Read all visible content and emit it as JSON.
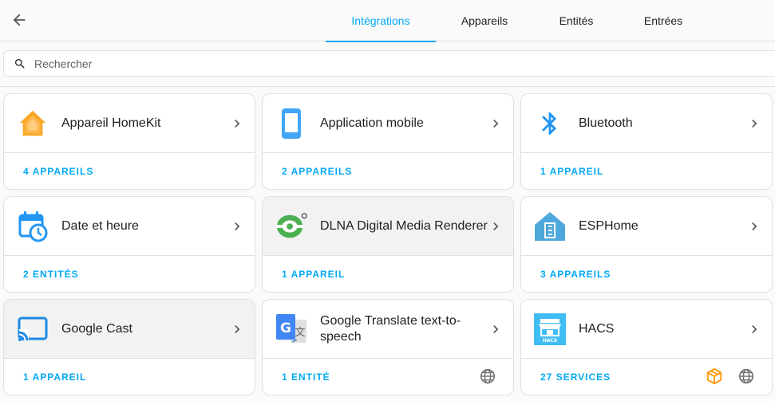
{
  "tabs": [
    {
      "label": "Intégrations",
      "active": true
    },
    {
      "label": "Appareils",
      "active": false
    },
    {
      "label": "Entités",
      "active": false
    },
    {
      "label": "Entrées",
      "active": false
    }
  ],
  "search": {
    "placeholder": "Rechercher"
  },
  "cards": [
    {
      "title": "Appareil HomeKit",
      "footer": "4 APPAREILS",
      "icon": "homekit-house-icon"
    },
    {
      "title": "Application mobile",
      "footer": "2 APPAREILS",
      "icon": "mobile-phone-icon"
    },
    {
      "title": "Bluetooth",
      "footer": "1 APPAREIL",
      "icon": "bluetooth-icon"
    },
    {
      "title": "Date et heure",
      "footer": "2 ENTITÉS",
      "icon": "calendar-clock-icon"
    },
    {
      "title": "DLNA Digital Media Renderer",
      "footer": "1 APPAREIL",
      "icon": "dlna-icon"
    },
    {
      "title": "ESPHome",
      "footer": "3 APPAREILS",
      "icon": "esphome-icon"
    },
    {
      "title": "Google Cast",
      "footer": "1 APPAREIL",
      "icon": "cast-icon"
    },
    {
      "title": "Google Translate text-to-speech",
      "footer": "1 ENTITÉ",
      "icon": "google-translate-icon",
      "footer_icons": [
        "cloud-globe-icon"
      ]
    },
    {
      "title": "HACS",
      "footer": "27 SERVICES",
      "icon": "hacs-store-icon",
      "footer_icons": [
        "custom-integration-icon",
        "cloud-globe-icon"
      ]
    }
  ],
  "colors": {
    "accent": "#03a9f4",
    "text": "#212121",
    "secondary": "#727272",
    "homekit": "#f9a825",
    "mobile": "#42a5f5",
    "bluetooth": "#2196f3",
    "dlna": "#4caf50",
    "esphome": "#4fa8dc",
    "hacs": "#41bdf5",
    "custom": "#ff9800"
  }
}
